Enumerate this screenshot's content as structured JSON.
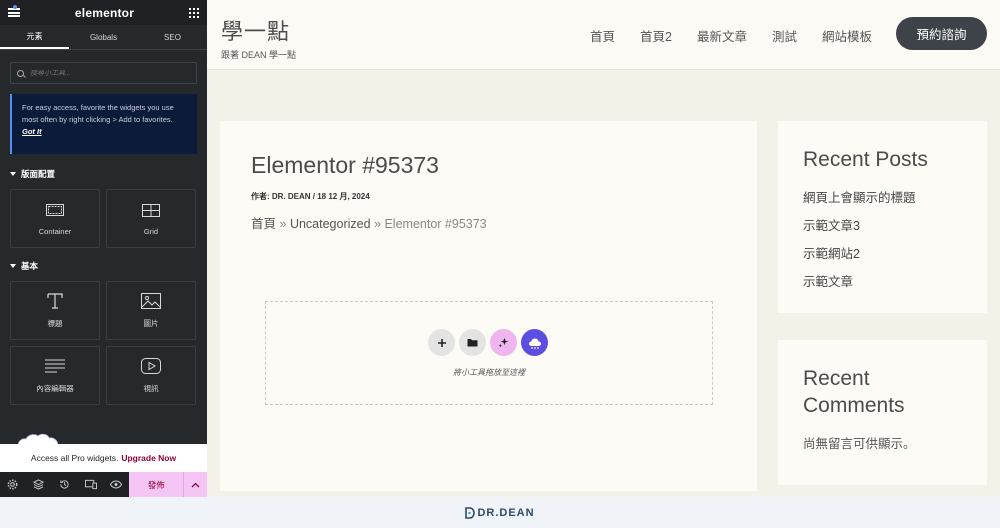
{
  "panel": {
    "logo": "elementor",
    "tabs": [
      {
        "label": "元素"
      },
      {
        "label": "Globals"
      },
      {
        "label": "SEO"
      }
    ],
    "search_placeholder": "搜尋小工具...",
    "notice": {
      "text": "For easy access, favorite the widgets you use most often by right clicking > Add to favorites.",
      "link": "Got It"
    },
    "sections": [
      {
        "title": "版面配置",
        "widgets": [
          {
            "label": "Container",
            "icon": "container-icon"
          },
          {
            "label": "Grid",
            "icon": "grid-icon"
          }
        ]
      },
      {
        "title": "基本",
        "widgets": [
          {
            "label": "標題",
            "icon": "heading-icon"
          },
          {
            "label": "圖片",
            "icon": "image-icon"
          },
          {
            "label": "內容編輯器",
            "icon": "text-editor-icon"
          },
          {
            "label": "視訊",
            "icon": "video-icon"
          }
        ]
      }
    ],
    "pro_bar": {
      "text": "Access all Pro widgets.",
      "link": "Upgrade Now"
    },
    "publish_label": "發佈"
  },
  "site": {
    "brand": {
      "title": "學一點",
      "subtitle": "跟著 DEAN 學一點"
    },
    "nav": [
      {
        "label": "首頁"
      },
      {
        "label": "首頁2"
      },
      {
        "label": "最新文章"
      },
      {
        "label": "測試"
      },
      {
        "label": "網站模板"
      }
    ],
    "cta": "預約諮詢",
    "post": {
      "title": "Elementor #95373",
      "meta": "作者: DR. DEAN / 18 12 月, 2024",
      "breadcrumb": {
        "home": "首頁",
        "sep": "»",
        "category": "Uncategorized",
        "current": "Elementor #95373"
      },
      "drop_text": "將小工具拖放至這裡"
    },
    "recent_posts": {
      "title": "Recent Posts",
      "items": [
        {
          "label": "網頁上會顯示的標題"
        },
        {
          "label": "示範文章3"
        },
        {
          "label": "示範網站2"
        },
        {
          "label": "示範文章"
        }
      ]
    },
    "recent_comments": {
      "title": "Recent Comments",
      "empty": "尚無留言可供顯示。"
    }
  },
  "footer": {
    "brand": "DR.DEAN"
  },
  "colors": {
    "accent": "#92003b",
    "publish_bg": "#f5c6f5",
    "dark": "#26292c",
    "cta": "#3e4349",
    "ai_pink": "#f0b5ee",
    "purple": "#5b4ee0"
  }
}
